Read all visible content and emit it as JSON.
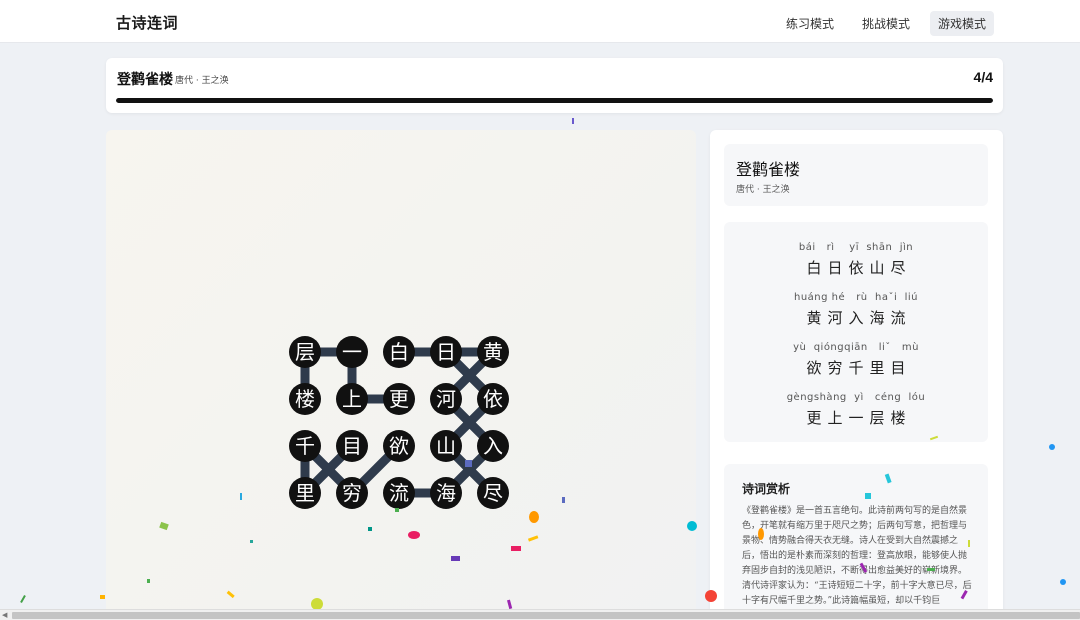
{
  "app": {
    "title": "古诗连词"
  },
  "nav": {
    "items": [
      {
        "label": "练习模式",
        "active": false
      },
      {
        "label": "挑战模式",
        "active": false
      },
      {
        "label": "游戏模式",
        "active": true
      }
    ]
  },
  "header": {
    "title": "登鹳雀楼",
    "subtitle": "唐代 · 王之涣",
    "progress_text": "4/4",
    "progress_fraction": 1.0
  },
  "board": {
    "rows": [
      [
        "层",
        "一",
        "白",
        "日",
        "黄"
      ],
      [
        "楼",
        "上",
        "更",
        "河",
        "依"
      ],
      [
        "千",
        "目",
        "欲",
        "山",
        "入"
      ],
      [
        "里",
        "穷",
        "流",
        "海",
        "尽"
      ]
    ],
    "paths": [
      [
        [
          0,
          4
        ],
        [
          1,
          3
        ],
        [
          2,
          4
        ],
        [
          3,
          3
        ]
      ],
      [
        [
          0,
          0
        ],
        [
          1,
          0
        ]
      ],
      [
        [
          0,
          1
        ],
        [
          1,
          1
        ]
      ],
      [
        [
          1,
          1
        ],
        [
          1,
          2
        ]
      ],
      [
        [
          0,
          2
        ],
        [
          0,
          4
        ]
      ],
      [
        [
          0,
          3
        ],
        [
          1,
          4
        ],
        [
          2,
          3
        ],
        [
          3,
          4
        ]
      ],
      [
        [
          2,
          0
        ],
        [
          3,
          1
        ]
      ],
      [
        [
          3,
          0
        ],
        [
          2,
          1
        ]
      ],
      [
        [
          2,
          0
        ],
        [
          3,
          0
        ]
      ],
      [
        [
          3,
          1
        ],
        [
          2,
          2
        ]
      ],
      [
        [
          3,
          2
        ],
        [
          3,
          3
        ]
      ],
      [
        [
          0,
          0
        ],
        [
          0,
          1
        ]
      ]
    ],
    "colors": {
      "tile": "#111111",
      "tile_text": "#ffffff",
      "path": "#2f3b4c"
    }
  },
  "poem": {
    "title": "登鹳雀楼",
    "subtitle": "唐代 · 王之涣",
    "lines": [
      {
        "pinyin": "bái   rì    yī  shān  jìn",
        "text": "白日依山尽"
      },
      {
        "pinyin": "huáng hé   rù  haˇi  liú",
        "text": "黄河入海流"
      },
      {
        "pinyin": "yù  qióngqiān   liˇ   mù",
        "text": "欲穷千里目"
      },
      {
        "pinyin": "gèngshàng  yì   céng  lóu",
        "text": "更上一层楼"
      }
    ]
  },
  "analysis": {
    "title": "诗词赏析",
    "text": "《登鹳雀楼》是一首五言绝句。此诗前两句写的是自然景色，开笔就有缩万里于咫尺之势；后两句写意，把哲理与景物、情势融合得天衣无缝。诗人在受到大自然震撼之后，悟出的是朴素而深刻的哲理：登高放眼，能够使人抛弃固步自封的浅见陋识，不断得出愈益美好的崭新境界。清代诗评家认为：“王诗短短二十字，前十字大意已尽，后十字有尺幅千里之势。”此诗篇幅虽短，却以千钧巨"
  }
}
